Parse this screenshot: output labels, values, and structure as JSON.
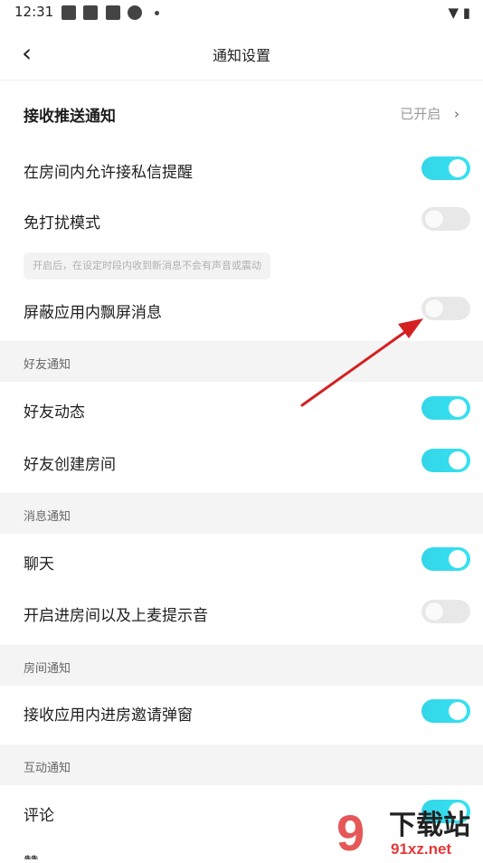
{
  "status_bar": {
    "time": "12:31"
  },
  "header": {
    "title": "通知设置"
  },
  "push": {
    "label": "接收推送通知",
    "value": "已开启"
  },
  "general": {
    "private_msg": {
      "label": "在房间内允许接私信提醒",
      "on": true
    },
    "dnd": {
      "label": "免打扰模式",
      "on": false
    },
    "dnd_hint": "开启后，在设定时段内收到新消息不会有声音或震动",
    "block_float": {
      "label": "屏蔽应用内飘屏消息",
      "on": false
    }
  },
  "friends": {
    "title": "好友通知",
    "dynamics": {
      "label": "好友动态",
      "on": true
    },
    "create_room": {
      "label": "好友创建房间",
      "on": true
    }
  },
  "messages": {
    "title": "消息通知",
    "chat": {
      "label": "聊天",
      "on": true
    },
    "enter_sound": {
      "label": "开启进房间以及上麦提示音",
      "on": false
    }
  },
  "room": {
    "title": "房间通知",
    "invite_popup": {
      "label": "接收应用内进房邀请弹窗",
      "on": true
    }
  },
  "interaction": {
    "title": "互动通知",
    "comment": {
      "label": "评论",
      "on": true
    },
    "like": {
      "label": "赞"
    }
  },
  "watermark": {
    "text1": "下载站",
    "text2": "91xz.net"
  },
  "colors": {
    "toggle_on": "#36dcee",
    "toggle_off": "#e8e8e8",
    "section_bg": "#f4f4f4",
    "arrow": "#d42020"
  }
}
